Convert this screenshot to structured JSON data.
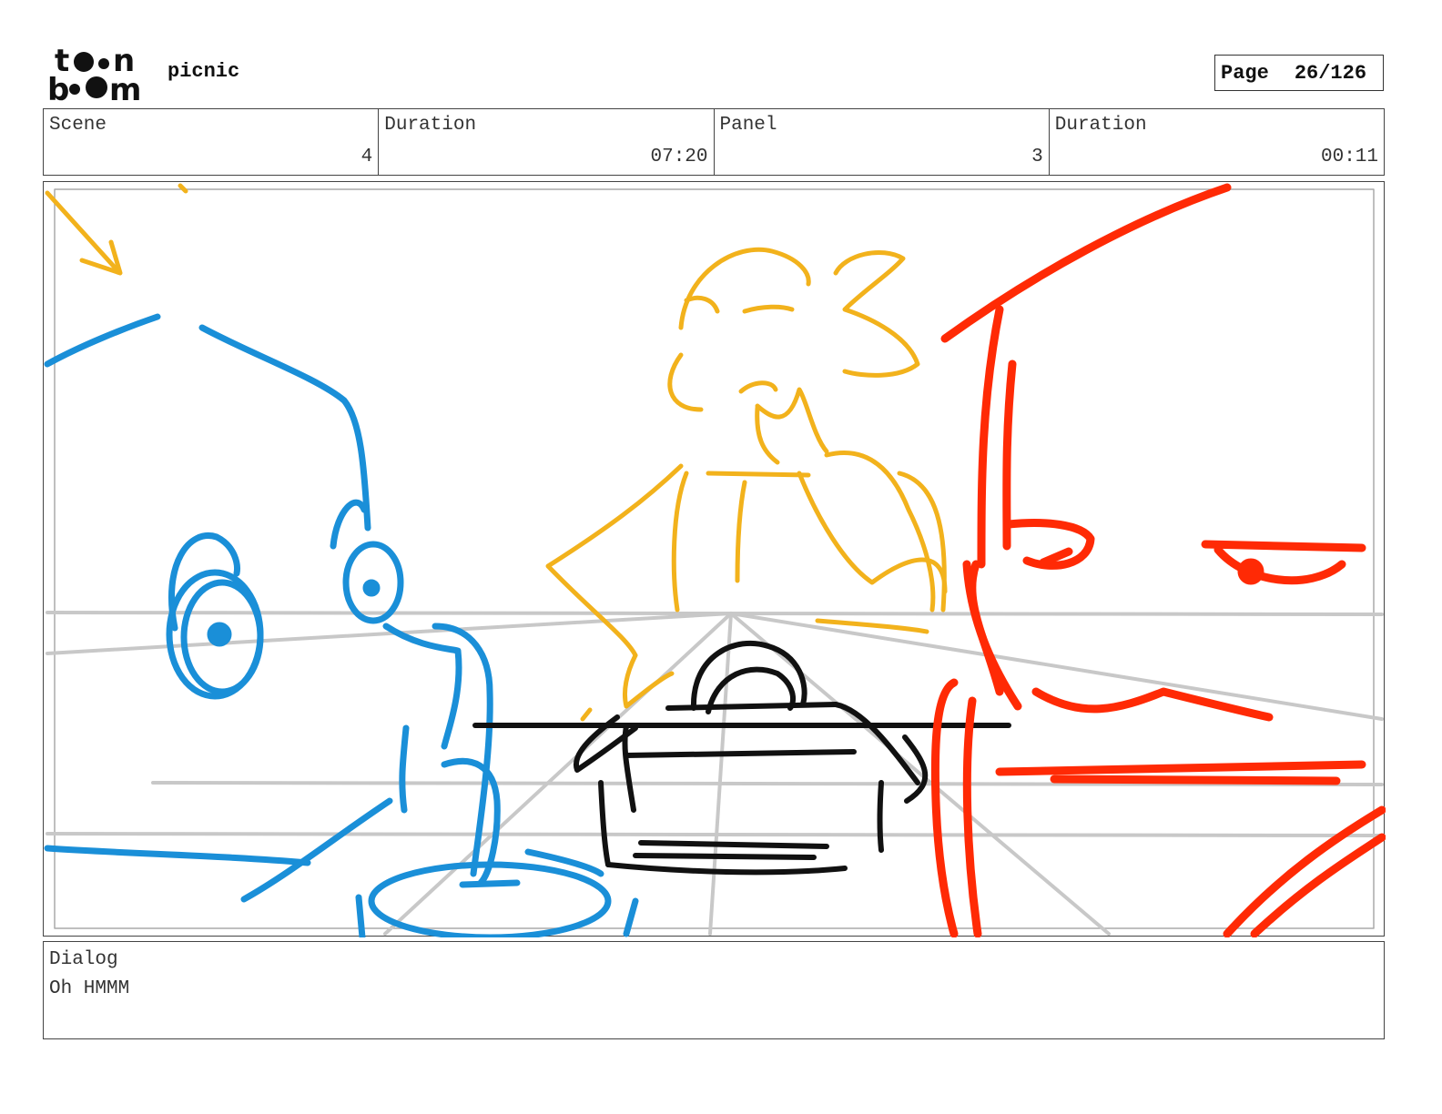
{
  "header": {
    "logo_text": "toon boom",
    "project_title": "picnic",
    "page_label": "Page",
    "page_number": "26/126"
  },
  "info_bar": {
    "scene": {
      "label": "Scene",
      "value": "4"
    },
    "scene_duration": {
      "label": "Duration",
      "value": "07:20"
    },
    "panel": {
      "label": "Panel",
      "value": "3"
    },
    "panel_duration": {
      "label": "Duration",
      "value": "00:11"
    }
  },
  "panel_image": {
    "colors": {
      "blue": "#1a8fd8",
      "yellow": "#f2b21c",
      "red": "#ff2a05",
      "black": "#111111",
      "guide": "#c8c8c8"
    }
  },
  "dialog": {
    "label": "Dialog",
    "text": "Oh HMMM"
  }
}
